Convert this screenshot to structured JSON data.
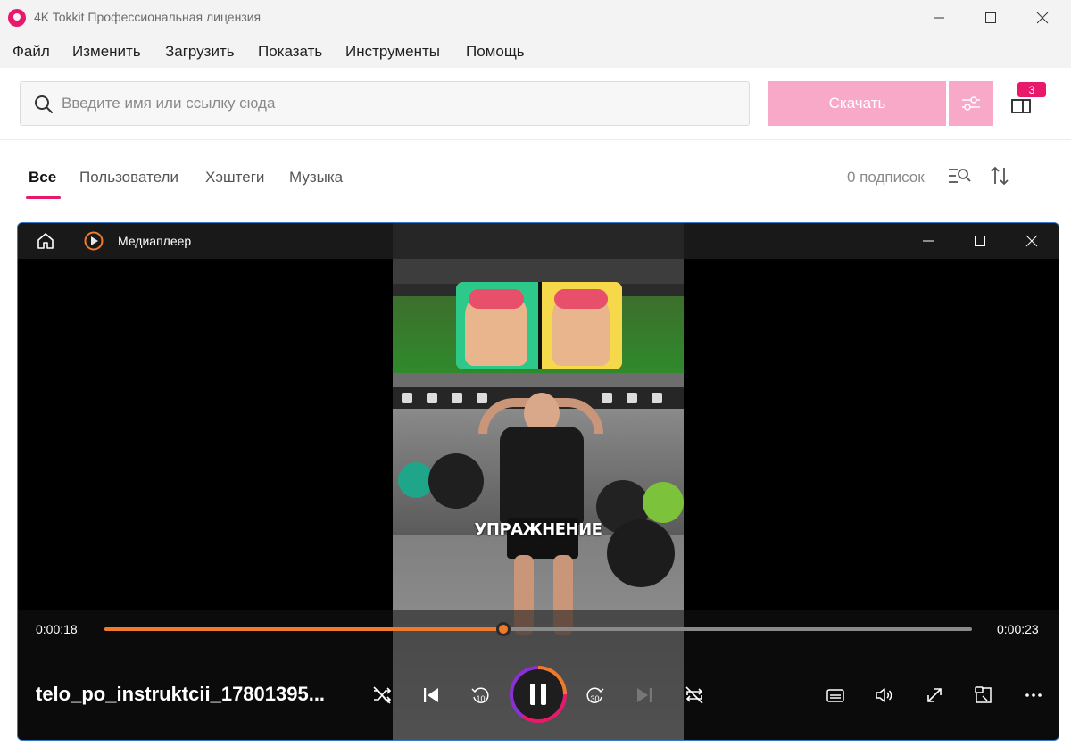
{
  "app": {
    "title": "4K Tokkit Профессиональная лицензия",
    "colors": {
      "accent": "#e8196a",
      "download_disabled": "#f8a9c7",
      "progress": "#f07a2c"
    }
  },
  "menu": {
    "items": [
      "Файл",
      "Изменить",
      "Загрузить",
      "Показать",
      "Инструменты",
      "Помощь"
    ]
  },
  "toolbar": {
    "search_placeholder": "Введите имя или ссылку сюда",
    "search_value": "",
    "download_label": "Скачать",
    "library_badge": "3"
  },
  "tabs": {
    "items": [
      "Все",
      "Пользователи",
      "Хэштеги",
      "Музыка"
    ],
    "active": "Все",
    "subscriptions": "0 подписок"
  },
  "player": {
    "title": "Медиаплеер",
    "video_caption": "УПРАЖНЕНИЕ",
    "time_current": "0:00:18",
    "time_total": "0:00:23",
    "progress_fraction": 0.46,
    "file_name": "telo_po_instruktcii_17801395...",
    "rewind_seconds": "10",
    "forward_seconds": "30",
    "state": "playing"
  },
  "icons": [
    "app-logo-icon",
    "minimize-icon",
    "maximize-icon",
    "close-icon",
    "search-icon",
    "settings-sliders-icon",
    "library-icon",
    "filter-search-icon",
    "sort-icon",
    "home-icon",
    "player-logo-icon",
    "shuffle-icon",
    "previous-icon",
    "rewind-10-icon",
    "pause-icon",
    "forward-30-icon",
    "next-icon",
    "repeat-icon",
    "subtitles-icon",
    "volume-icon",
    "fullscreen-icon",
    "mini-player-icon",
    "more-icon"
  ]
}
